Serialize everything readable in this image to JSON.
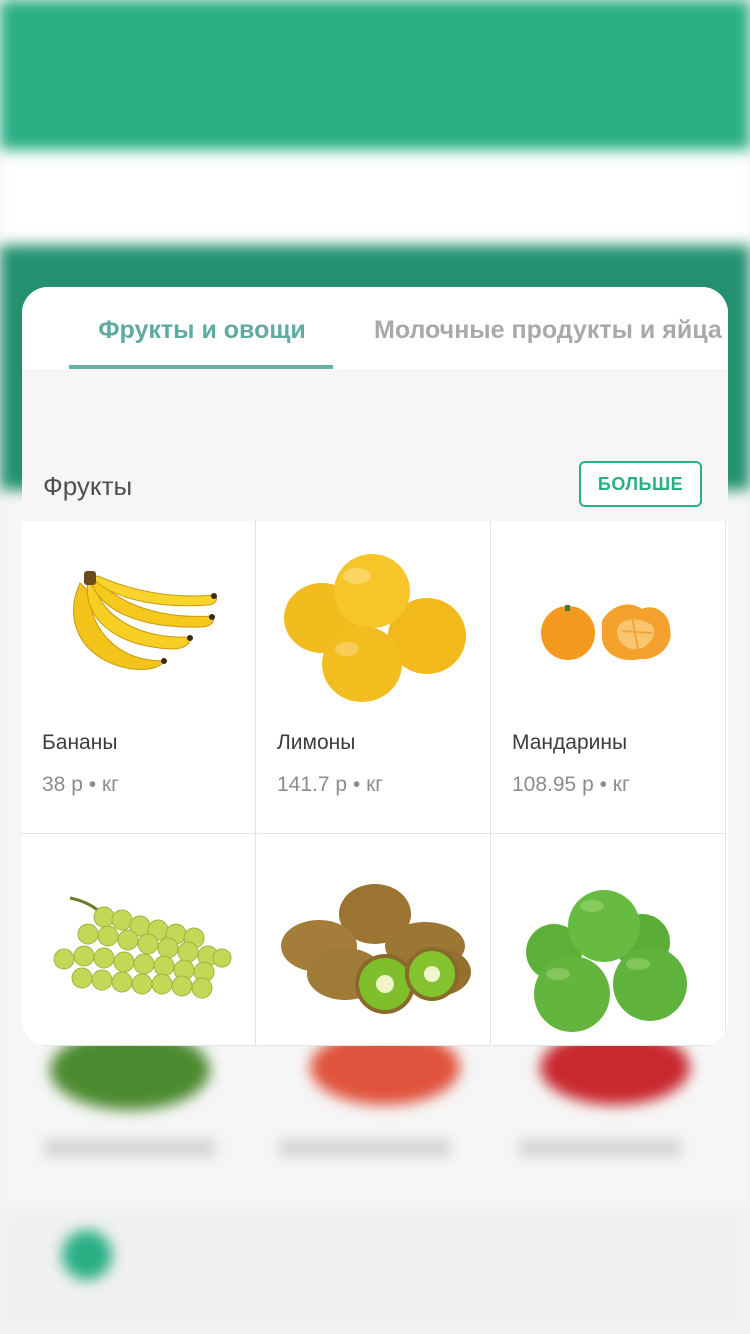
{
  "tabs": [
    {
      "label": "Фрукты и овощи",
      "active": true
    },
    {
      "label": "Молочные продукты и яйца",
      "active": false
    }
  ],
  "section": {
    "title": "Фрукты",
    "more_label": "БОЛЬШЕ"
  },
  "products": [
    {
      "name": "Бананы",
      "price": "38 р • кг",
      "icon": "banana-icon"
    },
    {
      "name": "Лимоны",
      "price": "141.7 р • кг",
      "icon": "lemon-icon"
    },
    {
      "name": "Мандарины",
      "price": "108.95 р • кг",
      "icon": "tangerine-icon"
    },
    {
      "name": "",
      "price": "",
      "icon": "grapes-icon"
    },
    {
      "name": "",
      "price": "",
      "icon": "kiwi-icon"
    },
    {
      "name": "",
      "price": "",
      "icon": "apple-icon"
    }
  ],
  "colors": {
    "brand": "#2aaf85",
    "accent_tab": "#5faaa1",
    "background_band": "#23916f"
  }
}
